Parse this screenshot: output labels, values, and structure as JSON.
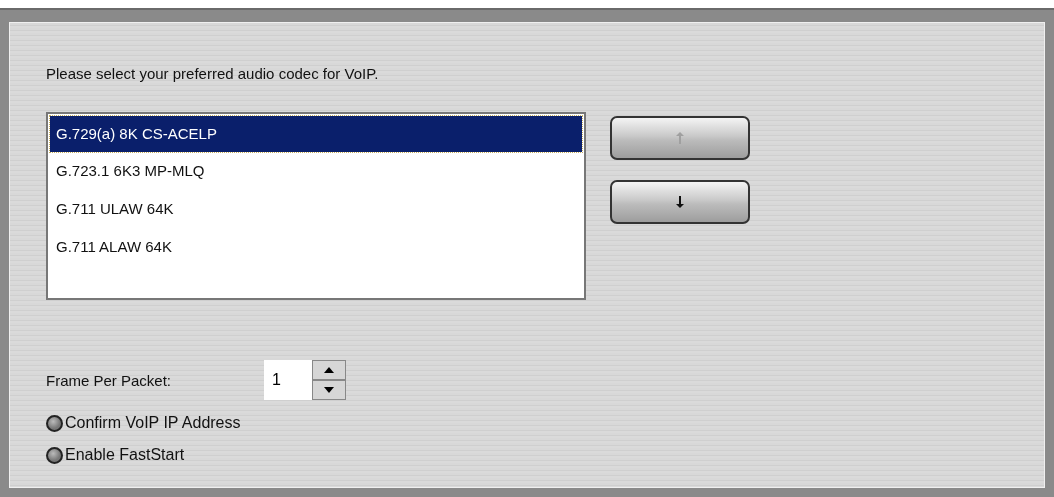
{
  "instruction": "Please select your preferred audio codec for VoIP.",
  "codecs": [
    {
      "label": "G.729(a) 8K CS-ACELP",
      "selected": true
    },
    {
      "label": "G.723.1 6K3 MP-MLQ",
      "selected": false
    },
    {
      "label": "G.711 ULAW 64K",
      "selected": false
    },
    {
      "label": "G.711 ALAW 64K",
      "selected": false
    }
  ],
  "move_buttons": [
    {
      "kind": "up",
      "disabled": true
    },
    {
      "kind": "down",
      "disabled": false
    }
  ],
  "frame_per_packet": {
    "label": "Frame Per Packet:",
    "value": "1"
  },
  "options": [
    {
      "label": "Confirm VoIP IP Address",
      "checked": false
    },
    {
      "label": "Enable FastStart",
      "checked": false
    }
  ]
}
